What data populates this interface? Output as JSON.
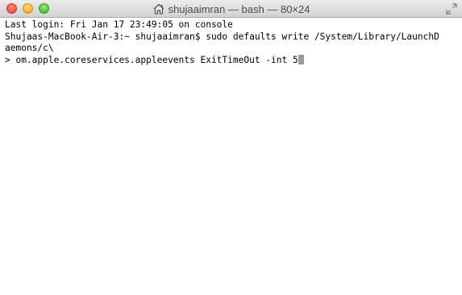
{
  "window": {
    "title": "shujaaimran — bash — 80×24",
    "title_icon": "home-icon",
    "controls": [
      "close",
      "minimize",
      "zoom"
    ],
    "fullscreen_icon": "fullscreen-icon"
  },
  "terminal": {
    "lines": [
      "Last login: Fri Jan 17 23:49:05 on console",
      "Shujaas-MacBook-Air-3:~ shujaaimran$ sudo defaults write /System/Library/LaunchD",
      "aemons/c\\",
      "> om.apple.coreservices.appleevents ExitTimeOut -int 5"
    ],
    "cursor_color": "#9a9a9a",
    "background": "#ffffff",
    "text_color": "#000000"
  }
}
